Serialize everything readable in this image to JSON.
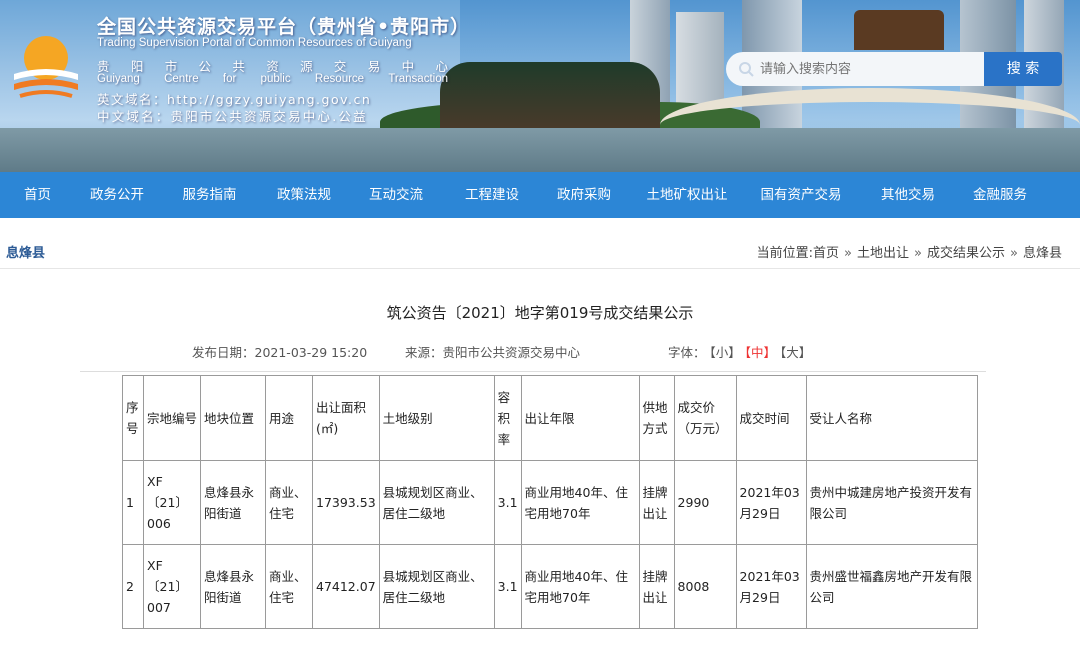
{
  "header": {
    "title_cn": "全国公共资源交易平台（贵州省•贵阳市）",
    "title_en": "Trading Supervision Portal of Common Resources of Guiyang",
    "center_cn": [
      "贵",
      "阳",
      "市",
      "公",
      "共",
      "资",
      "源",
      "交",
      "易",
      "中",
      "心"
    ],
    "center_en": [
      "Guiyang",
      "Centre",
      "for",
      "public",
      "Resource",
      "Transaction"
    ],
    "domain_en": "英文域名：http://ggzy.guiyang.gov.cn",
    "domain_cn": "中文域名：贵阳市公共资源交易中心.公益"
  },
  "search": {
    "placeholder": "请输入搜索内容",
    "button": "搜 索"
  },
  "nav": [
    "首页",
    "政务公开",
    "服务指南",
    "政策法规",
    "互动交流",
    "工程建设",
    "政府采购",
    "土地矿权出让",
    "国有资产交易",
    "其他交易",
    "金融服务"
  ],
  "section_title": "息烽县",
  "breadcrumb": {
    "prefix": "当前位置:",
    "items": [
      "首页",
      "土地出让",
      "成交结果公示",
      "息烽县"
    ]
  },
  "article": {
    "title": "筑公资告〔2021〕地字第019号成交结果公示",
    "publish": "发布日期：2021-03-29 15:20",
    "source": "来源：贵阳市公共资源交易中心",
    "font_label": "字体：",
    "font_sizes": [
      "【小】",
      "【中】",
      "【大】"
    ]
  },
  "table": {
    "headers": [
      "序号",
      "宗地编号",
      "地块位置",
      "用途",
      "出让面积(㎡)",
      "土地级别",
      "容积率",
      "出让年限",
      "供地方式",
      "成交价（万元）",
      "成交时间",
      "受让人名称"
    ],
    "rows": [
      [
        "1",
        "XF〔21〕006",
        "息烽县永阳街道",
        "商业、住宅",
        "17393.53",
        "县城规划区商业、居住二级地",
        "3.1",
        "商业用地40年、住宅用地70年",
        "挂牌出让",
        "2990",
        "2021年03月29日",
        "贵州中城建房地产投资开发有限公司"
      ],
      [
        "2",
        "XF〔21〕007",
        "息烽县永阳街道",
        "商业、住宅",
        "47412.07",
        "县城规划区商业、居住二级地",
        "3.1",
        "商业用地40年、住宅用地70年",
        "挂牌出让",
        "8008",
        "2021年03月29日",
        "贵州盛世福鑫房地产开发有限公司"
      ]
    ]
  }
}
